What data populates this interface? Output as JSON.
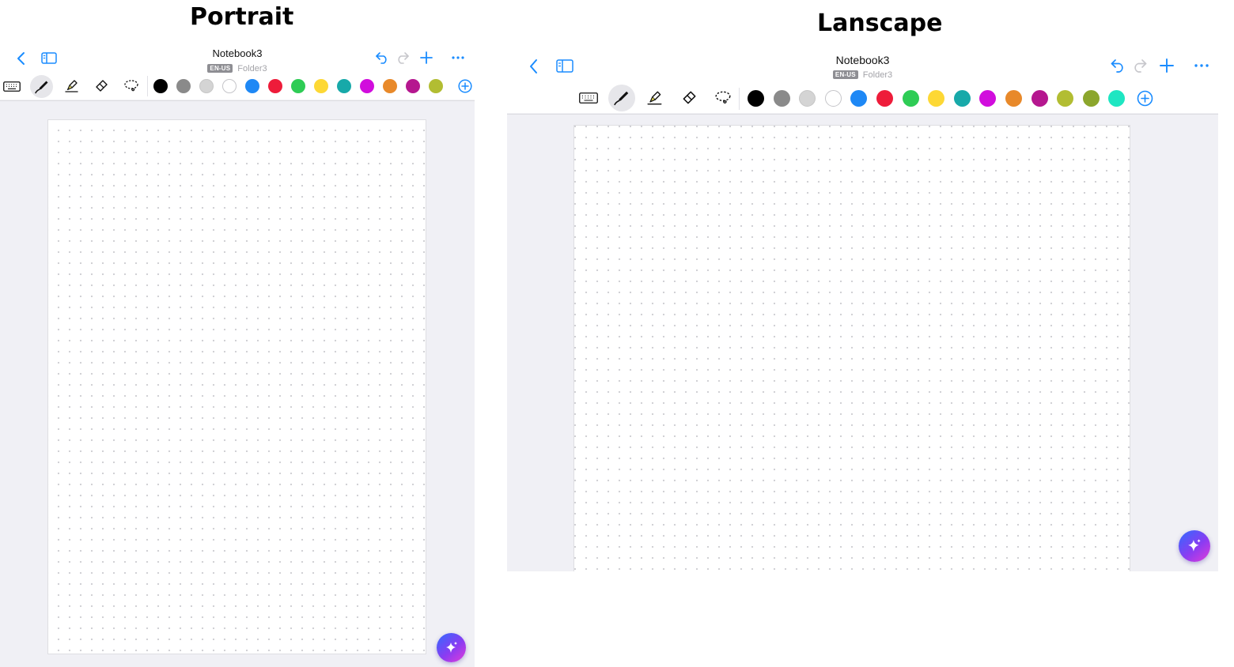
{
  "headings": {
    "portrait": "Portrait",
    "landscape": "Lanscape"
  },
  "notebook": {
    "title": "Notebook3",
    "language_badge": "EN-US",
    "folder": "Folder3"
  },
  "toolbar": {
    "tools": [
      "keyboard-icon",
      "pen-icon",
      "highlighter-icon",
      "eraser-icon",
      "lasso-icon"
    ],
    "active_tool": "pen-icon",
    "portrait_colors": [
      "#000000",
      "#8a8a8a",
      "#d4d4d4",
      "#ffffff",
      "#1e88f5",
      "#ee1c3a",
      "#2ecc55",
      "#fdd835",
      "#17a9a9",
      "#d10ddd",
      "#e8892a",
      "#b5178f",
      "#b2bd32"
    ],
    "landscape_colors": [
      "#000000",
      "#8a8a8a",
      "#d4d4d4",
      "#ffffff",
      "#1e88f5",
      "#ee1c3a",
      "#2ecc55",
      "#fdd835",
      "#17a9a9",
      "#d10ddd",
      "#e8892a",
      "#b5178f",
      "#b2bd32",
      "#8ca62c",
      "#1ee6c2"
    ],
    "add_color_icon": "plus-circle-icon"
  },
  "nav": {
    "left": [
      "chevron-left-icon",
      "sidebar-icon"
    ],
    "right": [
      "undo-icon",
      "redo-icon",
      "plus-icon",
      "more-icon"
    ]
  },
  "accent_color": "#1a8cff",
  "page_style": "dot-grid",
  "assistant_button": "sparkle-icon"
}
